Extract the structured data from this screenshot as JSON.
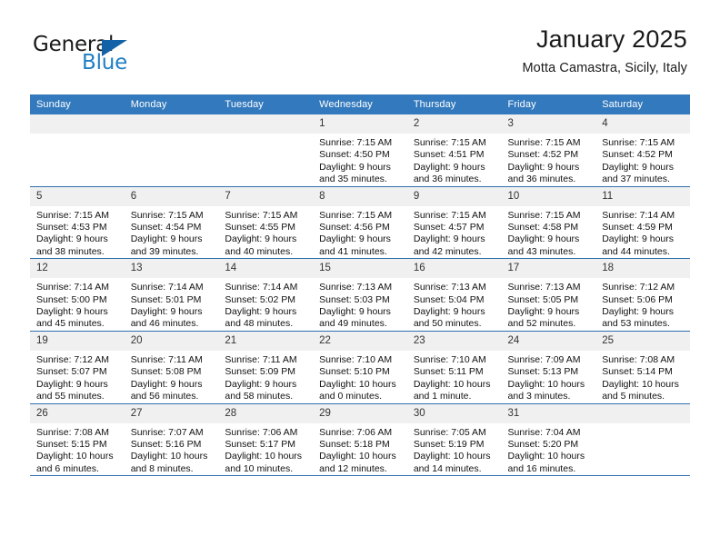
{
  "brand": {
    "word_one": "General",
    "word_two": "Blue",
    "triangle_icon": "triangle-icon",
    "accent_blue": "#1f7ec4",
    "logo_triangle_blue": "#1362a8"
  },
  "header": {
    "title": "January 2025",
    "subtitle": "Motta Camastra, Sicily, Italy"
  },
  "calendar": {
    "header_bg": "#3379bd",
    "daynum_bg": "#f0f0f0",
    "row_border": "#2f6fae",
    "weekday_headers": [
      "Sunday",
      "Monday",
      "Tuesday",
      "Wednesday",
      "Thursday",
      "Friday",
      "Saturday"
    ],
    "labels": {
      "sunrise": "Sunrise:",
      "sunset": "Sunset:",
      "daylight": "Daylight:"
    },
    "weeks": [
      [
        {
          "empty": true
        },
        {
          "empty": true
        },
        {
          "empty": true
        },
        {
          "day": "1",
          "sunrise": "Sunrise: 7:15 AM",
          "sunset": "Sunset: 4:50 PM",
          "daylight_line1": "Daylight: 9 hours",
          "daylight_line2": "and 35 minutes."
        },
        {
          "day": "2",
          "sunrise": "Sunrise: 7:15 AM",
          "sunset": "Sunset: 4:51 PM",
          "daylight_line1": "Daylight: 9 hours",
          "daylight_line2": "and 36 minutes."
        },
        {
          "day": "3",
          "sunrise": "Sunrise: 7:15 AM",
          "sunset": "Sunset: 4:52 PM",
          "daylight_line1": "Daylight: 9 hours",
          "daylight_line2": "and 36 minutes."
        },
        {
          "day": "4",
          "sunrise": "Sunrise: 7:15 AM",
          "sunset": "Sunset: 4:52 PM",
          "daylight_line1": "Daylight: 9 hours",
          "daylight_line2": "and 37 minutes."
        }
      ],
      [
        {
          "day": "5",
          "sunrise": "Sunrise: 7:15 AM",
          "sunset": "Sunset: 4:53 PM",
          "daylight_line1": "Daylight: 9 hours",
          "daylight_line2": "and 38 minutes."
        },
        {
          "day": "6",
          "sunrise": "Sunrise: 7:15 AM",
          "sunset": "Sunset: 4:54 PM",
          "daylight_line1": "Daylight: 9 hours",
          "daylight_line2": "and 39 minutes."
        },
        {
          "day": "7",
          "sunrise": "Sunrise: 7:15 AM",
          "sunset": "Sunset: 4:55 PM",
          "daylight_line1": "Daylight: 9 hours",
          "daylight_line2": "and 40 minutes."
        },
        {
          "day": "8",
          "sunrise": "Sunrise: 7:15 AM",
          "sunset": "Sunset: 4:56 PM",
          "daylight_line1": "Daylight: 9 hours",
          "daylight_line2": "and 41 minutes."
        },
        {
          "day": "9",
          "sunrise": "Sunrise: 7:15 AM",
          "sunset": "Sunset: 4:57 PM",
          "daylight_line1": "Daylight: 9 hours",
          "daylight_line2": "and 42 minutes."
        },
        {
          "day": "10",
          "sunrise": "Sunrise: 7:15 AM",
          "sunset": "Sunset: 4:58 PM",
          "daylight_line1": "Daylight: 9 hours",
          "daylight_line2": "and 43 minutes."
        },
        {
          "day": "11",
          "sunrise": "Sunrise: 7:14 AM",
          "sunset": "Sunset: 4:59 PM",
          "daylight_line1": "Daylight: 9 hours",
          "daylight_line2": "and 44 minutes."
        }
      ],
      [
        {
          "day": "12",
          "sunrise": "Sunrise: 7:14 AM",
          "sunset": "Sunset: 5:00 PM",
          "daylight_line1": "Daylight: 9 hours",
          "daylight_line2": "and 45 minutes."
        },
        {
          "day": "13",
          "sunrise": "Sunrise: 7:14 AM",
          "sunset": "Sunset: 5:01 PM",
          "daylight_line1": "Daylight: 9 hours",
          "daylight_line2": "and 46 minutes."
        },
        {
          "day": "14",
          "sunrise": "Sunrise: 7:14 AM",
          "sunset": "Sunset: 5:02 PM",
          "daylight_line1": "Daylight: 9 hours",
          "daylight_line2": "and 48 minutes."
        },
        {
          "day": "15",
          "sunrise": "Sunrise: 7:13 AM",
          "sunset": "Sunset: 5:03 PM",
          "daylight_line1": "Daylight: 9 hours",
          "daylight_line2": "and 49 minutes."
        },
        {
          "day": "16",
          "sunrise": "Sunrise: 7:13 AM",
          "sunset": "Sunset: 5:04 PM",
          "daylight_line1": "Daylight: 9 hours",
          "daylight_line2": "and 50 minutes."
        },
        {
          "day": "17",
          "sunrise": "Sunrise: 7:13 AM",
          "sunset": "Sunset: 5:05 PM",
          "daylight_line1": "Daylight: 9 hours",
          "daylight_line2": "and 52 minutes."
        },
        {
          "day": "18",
          "sunrise": "Sunrise: 7:12 AM",
          "sunset": "Sunset: 5:06 PM",
          "daylight_line1": "Daylight: 9 hours",
          "daylight_line2": "and 53 minutes."
        }
      ],
      [
        {
          "day": "19",
          "sunrise": "Sunrise: 7:12 AM",
          "sunset": "Sunset: 5:07 PM",
          "daylight_line1": "Daylight: 9 hours",
          "daylight_line2": "and 55 minutes."
        },
        {
          "day": "20",
          "sunrise": "Sunrise: 7:11 AM",
          "sunset": "Sunset: 5:08 PM",
          "daylight_line1": "Daylight: 9 hours",
          "daylight_line2": "and 56 minutes."
        },
        {
          "day": "21",
          "sunrise": "Sunrise: 7:11 AM",
          "sunset": "Sunset: 5:09 PM",
          "daylight_line1": "Daylight: 9 hours",
          "daylight_line2": "and 58 minutes."
        },
        {
          "day": "22",
          "sunrise": "Sunrise: 7:10 AM",
          "sunset": "Sunset: 5:10 PM",
          "daylight_line1": "Daylight: 10 hours",
          "daylight_line2": "and 0 minutes."
        },
        {
          "day": "23",
          "sunrise": "Sunrise: 7:10 AM",
          "sunset": "Sunset: 5:11 PM",
          "daylight_line1": "Daylight: 10 hours",
          "daylight_line2": "and 1 minute."
        },
        {
          "day": "24",
          "sunrise": "Sunrise: 7:09 AM",
          "sunset": "Sunset: 5:13 PM",
          "daylight_line1": "Daylight: 10 hours",
          "daylight_line2": "and 3 minutes."
        },
        {
          "day": "25",
          "sunrise": "Sunrise: 7:08 AM",
          "sunset": "Sunset: 5:14 PM",
          "daylight_line1": "Daylight: 10 hours",
          "daylight_line2": "and 5 minutes."
        }
      ],
      [
        {
          "day": "26",
          "sunrise": "Sunrise: 7:08 AM",
          "sunset": "Sunset: 5:15 PM",
          "daylight_line1": "Daylight: 10 hours",
          "daylight_line2": "and 6 minutes."
        },
        {
          "day": "27",
          "sunrise": "Sunrise: 7:07 AM",
          "sunset": "Sunset: 5:16 PM",
          "daylight_line1": "Daylight: 10 hours",
          "daylight_line2": "and 8 minutes."
        },
        {
          "day": "28",
          "sunrise": "Sunrise: 7:06 AM",
          "sunset": "Sunset: 5:17 PM",
          "daylight_line1": "Daylight: 10 hours",
          "daylight_line2": "and 10 minutes."
        },
        {
          "day": "29",
          "sunrise": "Sunrise: 7:06 AM",
          "sunset": "Sunset: 5:18 PM",
          "daylight_line1": "Daylight: 10 hours",
          "daylight_line2": "and 12 minutes."
        },
        {
          "day": "30",
          "sunrise": "Sunrise: 7:05 AM",
          "sunset": "Sunset: 5:19 PM",
          "daylight_line1": "Daylight: 10 hours",
          "daylight_line2": "and 14 minutes."
        },
        {
          "day": "31",
          "sunrise": "Sunrise: 7:04 AM",
          "sunset": "Sunset: 5:20 PM",
          "daylight_line1": "Daylight: 10 hours",
          "daylight_line2": "and 16 minutes."
        },
        {
          "empty": true
        }
      ]
    ]
  }
}
